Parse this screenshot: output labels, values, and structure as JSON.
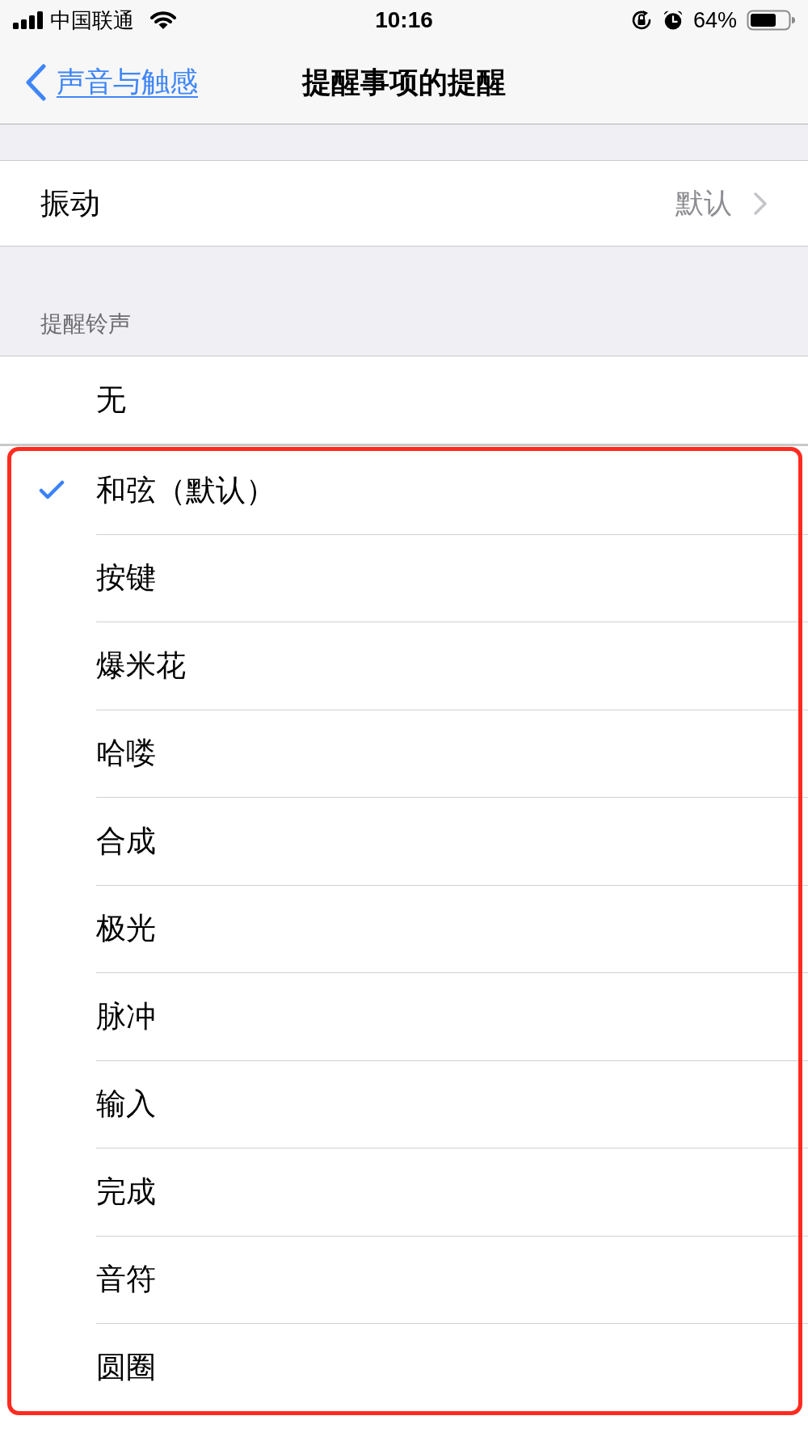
{
  "status_bar": {
    "carrier": "中国联通",
    "time": "10:16",
    "battery": "64%"
  },
  "nav": {
    "back": "声音与触感",
    "title": "提醒事项的提醒"
  },
  "vibration": {
    "label": "振动",
    "value": "默认"
  },
  "ringtones": {
    "header": "提醒铃声",
    "groups": [
      {
        "framed": false,
        "items": [
          {
            "label": "无",
            "selected": false
          }
        ]
      },
      {
        "framed": true,
        "items": [
          {
            "label": "和弦（默认）",
            "selected": true
          },
          {
            "label": "按键",
            "selected": false
          },
          {
            "label": "爆米花",
            "selected": false
          },
          {
            "label": "哈喽",
            "selected": false
          },
          {
            "label": "合成",
            "selected": false
          },
          {
            "label": "极光",
            "selected": false
          },
          {
            "label": "脉冲",
            "selected": false
          },
          {
            "label": "输入",
            "selected": false
          },
          {
            "label": "完成",
            "selected": false
          },
          {
            "label": "音符",
            "selected": false
          },
          {
            "label": "圆圈",
            "selected": false
          }
        ]
      }
    ]
  }
}
